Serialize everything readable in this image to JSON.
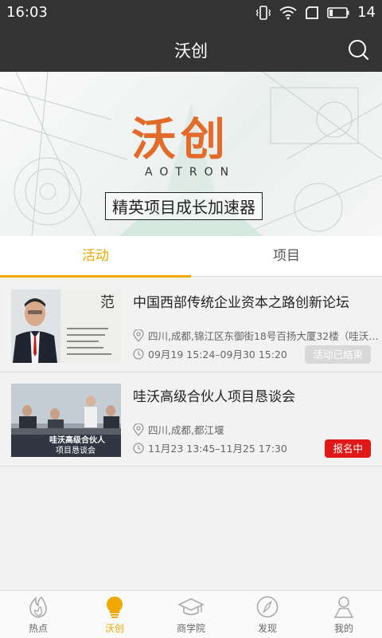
{
  "status_bar": {
    "time": "16:03",
    "battery": "14"
  },
  "header": {
    "title": "沃创"
  },
  "banner": {
    "logo_text": "沃创",
    "logo_sub": "AOTRON",
    "slogan": "精英项目成长加速器"
  },
  "tabs": [
    {
      "label": "活动",
      "active": true
    },
    {
      "label": "项目",
      "active": false
    }
  ],
  "events": [
    {
      "title": "中国西部传统企业资本之路创新论坛",
      "location": "四川,成都,锦江区东御街18号百扬大厦32楼（哇沃…",
      "time": "09月19 15:24–09月30 15:20",
      "status": "活动已结束"
    },
    {
      "title": "哇沃高级合伙人项目恳谈会",
      "location": "四川,成都,都江堰",
      "time": "11月23 13:45–11月25 17:30",
      "status": "报名中",
      "thumb_caption_1": "哇沃高级合伙人",
      "thumb_caption_2": "项目恳谈会"
    }
  ],
  "bottom_nav": [
    {
      "label": "热点",
      "icon": "flame-icon"
    },
    {
      "label": "沃创",
      "icon": "bulb-icon",
      "active": true
    },
    {
      "label": "商学院",
      "icon": "graduation-cap-icon"
    },
    {
      "label": "发现",
      "icon": "compass-icon"
    },
    {
      "label": "我的",
      "icon": "person-icon"
    }
  ],
  "colors": {
    "accent": "#f0a800",
    "header_bg": "#333333",
    "badge_red": "#e01818",
    "badge_gray": "#d8d8d8",
    "logo_orange": "#e46a2a"
  }
}
